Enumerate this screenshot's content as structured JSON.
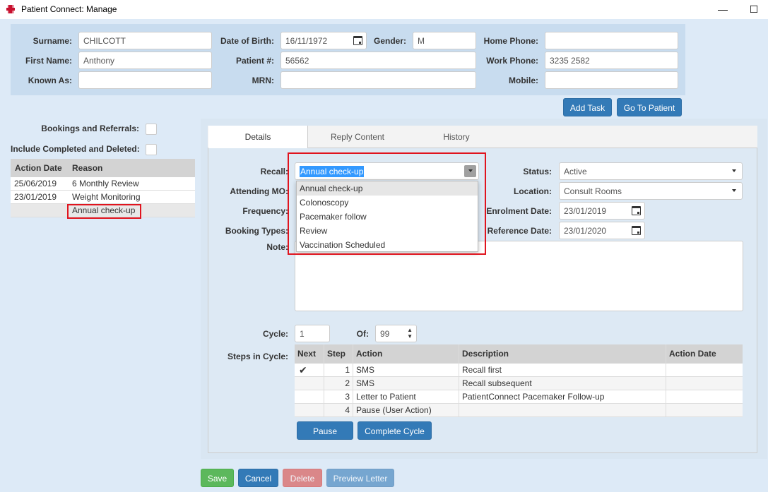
{
  "window": {
    "title": "Patient Connect: Manage",
    "minimize_glyph": "—",
    "maximize_glyph": "☐"
  },
  "patient": {
    "surname_label": "Surname:",
    "surname": "CHILCOTT",
    "first_name_label": "First Name:",
    "first_name": "Anthony",
    "known_as_label": "Known As:",
    "known_as": "",
    "dob_label": "Date of Birth:",
    "dob": "16/11/1972",
    "gender_label": "Gender:",
    "gender": "M",
    "patient_num_label": "Patient #:",
    "patient_num": "56562",
    "mrn_label": "MRN:",
    "mrn": "",
    "home_phone_label": "Home Phone:",
    "home_phone": "",
    "work_phone_label": "Work Phone:",
    "work_phone": "3235 2582",
    "mobile_label": "Mobile:",
    "mobile": ""
  },
  "actions": {
    "add_task": "Add Task",
    "go_to_patient": "Go To Patient"
  },
  "filters": {
    "bookings_label": "Bookings and Referrals:",
    "include_completed_label": "Include Completed and Deleted:"
  },
  "task_list": {
    "headers": [
      "Action Date",
      "Reason"
    ],
    "rows": [
      {
        "date": "25/06/2019",
        "reason": "6 Monthly Review"
      },
      {
        "date": "23/01/2019",
        "reason": "Weight Monitoring"
      },
      {
        "date": "",
        "reason": "Annual check-up"
      }
    ]
  },
  "tabs": [
    "Details",
    "Reply Content",
    "History"
  ],
  "details": {
    "recall_label": "Recall:",
    "recall_value": "Annual check-up",
    "recall_options": [
      "Annual check-up",
      "Colonoscopy",
      "Pacemaker follow",
      "Review",
      "Vaccination Scheduled"
    ],
    "attending_label": "Attending MO:",
    "frequency_label": "Frequency:",
    "booking_types_label": "Booking Types:",
    "note_label": "Note:",
    "status_label": "Status:",
    "status_value": "Active",
    "location_label": "Location:",
    "location_value": "Consult Rooms",
    "enrolment_label": "Enrolment Date:",
    "enrolment_value": "23/01/2019",
    "reference_label": "Reference Date:",
    "reference_value": "23/01/2020",
    "cycle_label": "Cycle:",
    "cycle_value": "1",
    "of_label": "Of:",
    "of_value": "99",
    "steps_label": "Steps in Cycle:"
  },
  "steps": {
    "headers": [
      "Next",
      "Step",
      "Action",
      "Description",
      "Action Date"
    ],
    "rows": [
      {
        "next": "✔",
        "step": "1",
        "action": "SMS",
        "description": "Recall first",
        "date": ""
      },
      {
        "next": "",
        "step": "2",
        "action": "SMS",
        "description": "Recall subsequent",
        "date": ""
      },
      {
        "next": "",
        "step": "3",
        "action": "Letter to Patient",
        "description": "PatientConnect Pacemaker Follow-up",
        "date": ""
      },
      {
        "next": "",
        "step": "4",
        "action": "Pause (User Action)",
        "description": "",
        "date": ""
      }
    ],
    "pause_button": "Pause",
    "complete_button": "Complete Cycle"
  },
  "footer": {
    "save": "Save",
    "cancel": "Cancel",
    "delete": "Delete",
    "preview": "Preview Letter"
  },
  "colors": {
    "primary": "#337ab7",
    "success": "#5cb85c",
    "danger": "#d9534f",
    "highlight": "#e0141e",
    "selection": "#3399ff"
  }
}
